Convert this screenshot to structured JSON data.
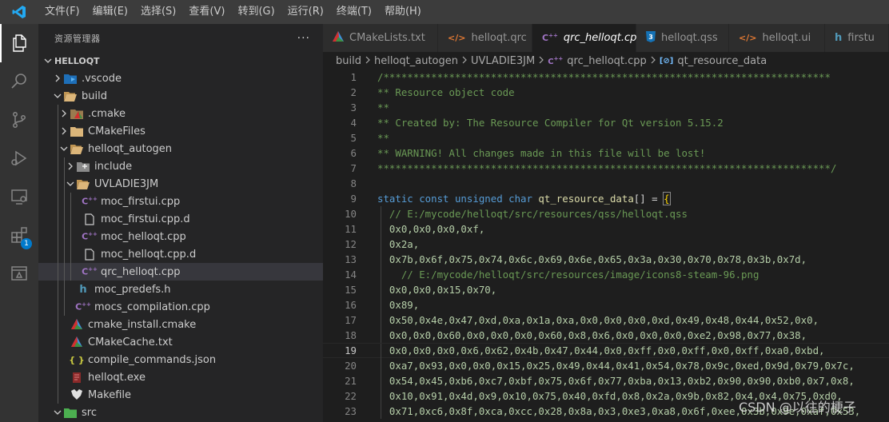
{
  "menu": [
    "文件(F)",
    "编辑(E)",
    "选择(S)",
    "查看(V)",
    "转到(G)",
    "运行(R)",
    "终端(T)",
    "帮助(H)"
  ],
  "activity": {
    "extensions_badge": "1"
  },
  "explorer": {
    "title": "资源管理器",
    "more": "···",
    "section": "HELLOQT",
    "items": [
      {
        "label": ".vscode",
        "depth": 1,
        "chevron": "right",
        "icon": "vscode-folder-icon"
      },
      {
        "label": "build",
        "depth": 1,
        "chevron": "down",
        "icon": "folder-open-icon"
      },
      {
        "label": ".cmake",
        "depth": 2,
        "chevron": "right",
        "icon": "cmake-folder-icon"
      },
      {
        "label": "CMakeFiles",
        "depth": 2,
        "chevron": "right",
        "icon": "folder-icon"
      },
      {
        "label": "helloqt_autogen",
        "depth": 2,
        "chevron": "down",
        "icon": "folder-open-icon"
      },
      {
        "label": "include",
        "depth": 3,
        "chevron": "right",
        "icon": "include-folder-icon"
      },
      {
        "label": "UVLADIE3JM",
        "depth": 3,
        "chevron": "down",
        "icon": "folder-open-icon"
      },
      {
        "label": "moc_firstui.cpp",
        "depth": 4,
        "chevron": "",
        "icon": "cpp-file-icon"
      },
      {
        "label": "moc_firstui.cpp.d",
        "depth": 4,
        "chevron": "",
        "icon": "file-icon"
      },
      {
        "label": "moc_helloqt.cpp",
        "depth": 4,
        "chevron": "",
        "icon": "cpp-file-icon"
      },
      {
        "label": "moc_helloqt.cpp.d",
        "depth": 4,
        "chevron": "",
        "icon": "file-icon"
      },
      {
        "label": "qrc_helloqt.cpp",
        "depth": 4,
        "chevron": "",
        "icon": "cpp-file-icon",
        "selected": true
      },
      {
        "label": "moc_predefs.h",
        "depth": 3,
        "chevron": "",
        "icon": "h-file-icon"
      },
      {
        "label": "mocs_compilation.cpp",
        "depth": 3,
        "chevron": "",
        "icon": "cpp-file-icon"
      },
      {
        "label": "cmake_install.cmake",
        "depth": 2,
        "chevron": "",
        "icon": "cmake-file-icon"
      },
      {
        "label": "CMakeCache.txt",
        "depth": 2,
        "chevron": "",
        "icon": "cmake-file-icon"
      },
      {
        "label": "compile_commands.json",
        "depth": 2,
        "chevron": "",
        "icon": "json-file-icon"
      },
      {
        "label": "helloqt.exe",
        "depth": 2,
        "chevron": "",
        "icon": "exe-file-icon"
      },
      {
        "label": "Makefile",
        "depth": 2,
        "chevron": "",
        "icon": "makefile-icon"
      },
      {
        "label": "src",
        "depth": 1,
        "chevron": "down",
        "icon": "src-folder-icon"
      }
    ]
  },
  "tabs": [
    {
      "label": "CMakeLists.txt",
      "icon": "cmake-file-icon",
      "active": false
    },
    {
      "label": "helloqt.qrc",
      "icon": "xml-file-icon",
      "active": false
    },
    {
      "label": "qrc_helloqt.cpp",
      "icon": "cpp-file-icon",
      "active": true,
      "close": "×"
    },
    {
      "label": "helloqt.qss",
      "icon": "css-file-icon",
      "active": false
    },
    {
      "label": "helloqt.ui",
      "icon": "xml-file-icon",
      "active": false
    },
    {
      "label": "firstu",
      "icon": "h-file-icon",
      "active": false
    }
  ],
  "breadcrumb": [
    "build",
    "helloqt_autogen",
    "UVLADIE3JM",
    "qrc_helloqt.cpp",
    "qt_resource_data"
  ],
  "editor": {
    "current_line": 19,
    "lines": [
      {
        "n": "1",
        "tokens": [
          {
            "t": "/***************************************************************************",
            "c": "comment"
          }
        ]
      },
      {
        "n": "2",
        "tokens": [
          {
            "t": "** Resource object code",
            "c": "comment"
          }
        ]
      },
      {
        "n": "3",
        "tokens": [
          {
            "t": "**",
            "c": "comment"
          }
        ]
      },
      {
        "n": "4",
        "tokens": [
          {
            "t": "** Created by: The Resource Compiler for Qt version 5.15.2",
            "c": "comment"
          }
        ]
      },
      {
        "n": "5",
        "tokens": [
          {
            "t": "**",
            "c": "comment"
          }
        ]
      },
      {
        "n": "6",
        "tokens": [
          {
            "t": "** WARNING! All changes made in this file will be lost!",
            "c": "comment"
          }
        ]
      },
      {
        "n": "7",
        "tokens": [
          {
            "t": "****************************************************************************/",
            "c": "comment"
          }
        ]
      },
      {
        "n": "8",
        "tokens": []
      },
      {
        "n": "9",
        "tokens": [
          {
            "t": "static const unsigned char ",
            "c": "kw"
          },
          {
            "t": "qt_resource_data",
            "c": "fn"
          },
          {
            "t": "[] = ",
            "c": "plain"
          },
          {
            "t": "{",
            "c": "brace"
          }
        ]
      },
      {
        "n": "10",
        "tokens": [
          {
            "t": "  // E:/mycode/helloqt/src/resources/qss/helloqt.qss",
            "c": "comment"
          }
        ]
      },
      {
        "n": "11",
        "tokens": [
          {
            "t": "  0x0,0x0,0x0,0xf,",
            "c": "num"
          }
        ]
      },
      {
        "n": "12",
        "tokens": [
          {
            "t": "  0x2a,",
            "c": "num"
          }
        ]
      },
      {
        "n": "13",
        "tokens": [
          {
            "t": "  0x7b,0x6f,0x75,0x74,0x6c,0x69,0x6e,0x65,0x3a,0x30,0x70,0x78,0x3b,0x7d,",
            "c": "num"
          }
        ]
      },
      {
        "n": "14",
        "tokens": [
          {
            "t": "    // E:/mycode/helloqt/src/resources/image/icons8-steam-96.png",
            "c": "comment"
          }
        ]
      },
      {
        "n": "15",
        "tokens": [
          {
            "t": "  0x0,0x0,0x15,0x70,",
            "c": "num"
          }
        ]
      },
      {
        "n": "16",
        "tokens": [
          {
            "t": "  0x89,",
            "c": "num"
          }
        ]
      },
      {
        "n": "17",
        "tokens": [
          {
            "t": "  0x50,0x4e,0x47,0xd,0xa,0x1a,0xa,0x0,0x0,0x0,0xd,0x49,0x48,0x44,0x52,0x0,",
            "c": "num"
          }
        ]
      },
      {
        "n": "18",
        "tokens": [
          {
            "t": "  0x0,0x0,0x60,0x0,0x0,0x0,0x60,0x8,0x6,0x0,0x0,0x0,0xe2,0x98,0x77,0x38,",
            "c": "num"
          }
        ]
      },
      {
        "n": "19",
        "tokens": [
          {
            "t": "  0x0,0x0,0x0,0x6,0x62,0x4b,0x47,0x44,0x0,0xff,0x0,0xff,0x0,0xff,0xa0,0xbd,",
            "c": "num"
          }
        ]
      },
      {
        "n": "20",
        "tokens": [
          {
            "t": "  0xa7,0x93,0x0,0x0,0x15,0x25,0x49,0x44,0x41,0x54,0x78,0x9c,0xed,0x9d,0x79,0x7c,",
            "c": "num"
          }
        ]
      },
      {
        "n": "21",
        "tokens": [
          {
            "t": "  0x54,0x45,0xb6,0xc7,0xbf,0x75,0x6f,0x77,0xba,0x13,0xb2,0x90,0x90,0xb0,0x7,0x8,",
            "c": "num"
          }
        ]
      },
      {
        "n": "22",
        "tokens": [
          {
            "t": "  0x10,0x91,0x4d,0x9,0x10,0x75,0x40,0xfd,0x8,0x2a,0x9b,0x82,0x4,0x4,0x75,0xd0,",
            "c": "num"
          }
        ]
      },
      {
        "n": "23",
        "tokens": [
          {
            "t": "  0x71,0xc6,0x8f,0xca,0xcc,0x28,0x8a,0x3,0xe3,0xa8,0x6f,0xee,0x3b,0x9e,0xaf,0x53,",
            "c": "num"
          }
        ]
      }
    ]
  },
  "watermark": "CSDN @以往的梗子",
  "colors": {
    "accent": "#007acc",
    "comment": "#6a9955",
    "keyword": "#569cd6",
    "function": "#dcdcaa",
    "number": "#b5cea8"
  }
}
